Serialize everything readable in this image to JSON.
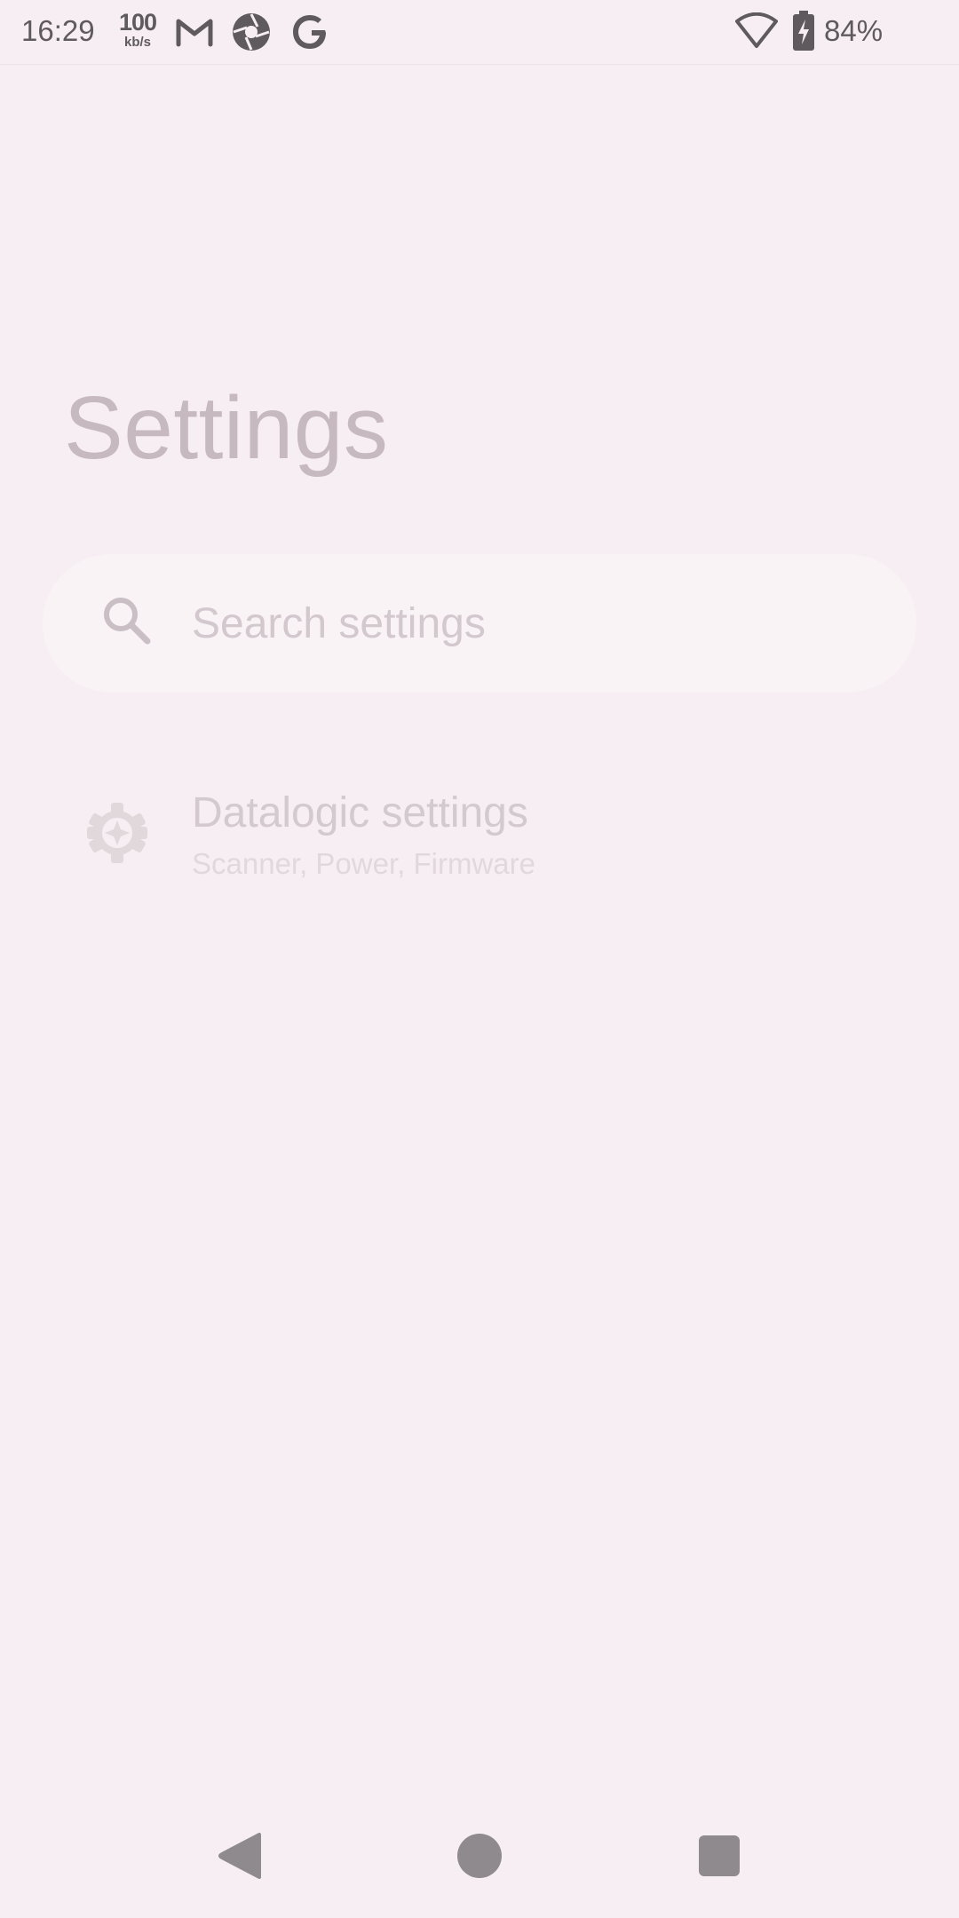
{
  "status_bar": {
    "time": "16:29",
    "net_speed_value": "100",
    "net_speed_unit": "kb/s",
    "notification_icons": [
      "gmail-icon",
      "camera-app-icon",
      "google-icon"
    ],
    "wifi_icon": "wifi-icon",
    "battery_icon": "battery-charging-icon",
    "battery_percent": "84%"
  },
  "page": {
    "title": "Settings"
  },
  "search": {
    "placeholder": "Search settings",
    "icon": "search-icon"
  },
  "items": [
    {
      "icon": "datalogic-gear-icon",
      "title": "Datalogic settings",
      "subtitle": "Scanner, Power, Firmware"
    }
  ],
  "nav_bar": {
    "buttons": [
      "back-button",
      "home-button",
      "recents-button"
    ]
  },
  "colors": {
    "background": "#f7eef3",
    "search_background": "#f9f3f6",
    "title_text": "#c6b9bf",
    "status_text": "#5f5a5d"
  }
}
